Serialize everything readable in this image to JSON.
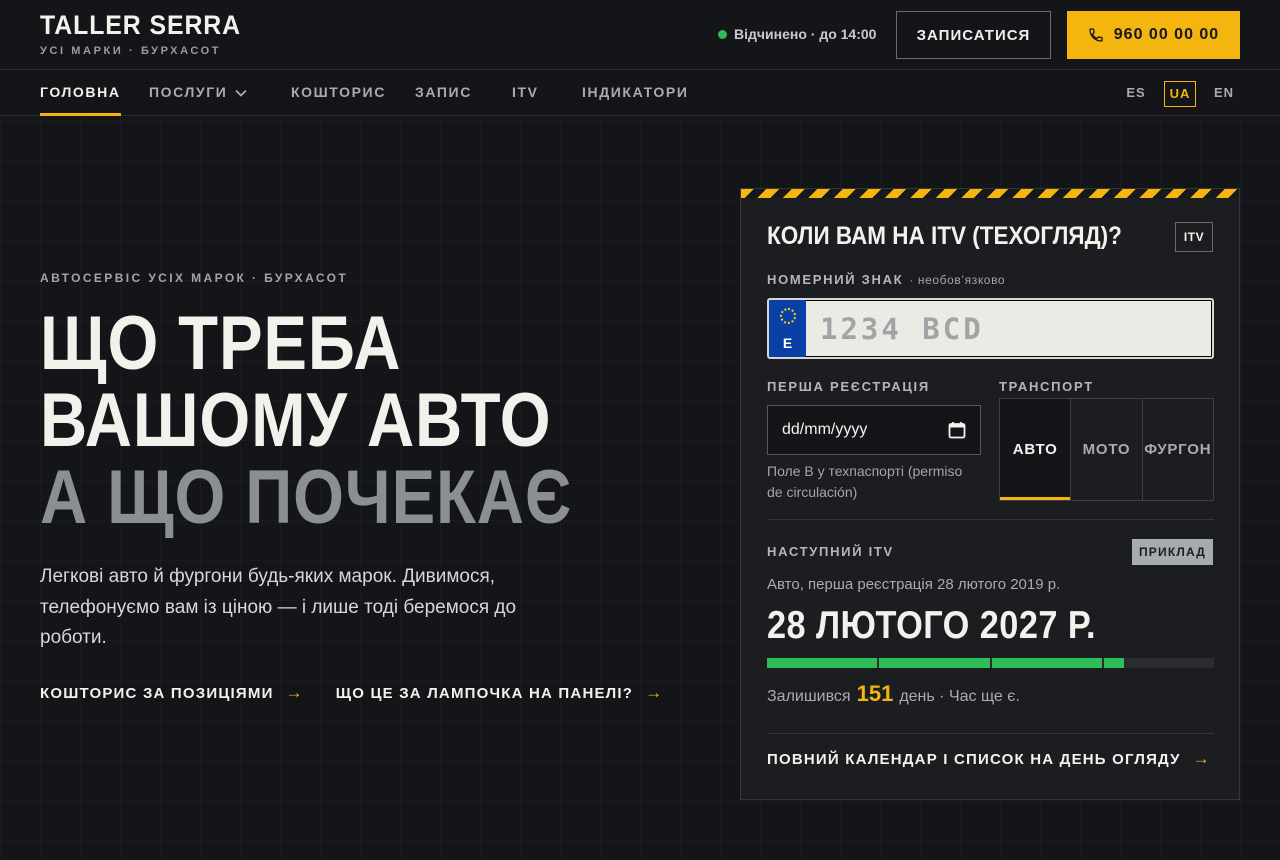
{
  "brand": {
    "name": "TALLER SERRA",
    "tagline": "УСІ МАРКИ · БУРХАСОТ"
  },
  "header": {
    "status_text": "Відчинено · до 14:00",
    "book_label": "ЗАПИСАТИСЯ",
    "phone_label": "960 00 00 00",
    "accent_color": "#f5b50f",
    "status_color": "#2dbe5a"
  },
  "nav": {
    "items": [
      {
        "label": "ГОЛОВНА"
      },
      {
        "label": "ПОСЛУГИ"
      },
      {
        "label": "КОШТОРИС"
      },
      {
        "label": "ЗАПИС"
      },
      {
        "label": "ITV"
      },
      {
        "label": "ІНДИКАТОРИ"
      }
    ],
    "active_index": 0,
    "languages": [
      "ES",
      "UA",
      "EN"
    ],
    "active_language": "UA"
  },
  "hero": {
    "eyebrow": "АВТОСЕРВІС УСІХ МАРОК · БУРХАСОТ",
    "headline_1": "ЩО ТРЕБА",
    "headline_2": "ВАШОМУ АВТО",
    "headline_3": "А ЩО ПОЧЕКАЄ",
    "lead": "Легкові авто й фургони будь-яких марок. Дивимося, телефонуємо вам із ціною — і лише тоді беремося до роботи.",
    "link_1": "КОШТОРИС ЗА ПОЗИЦІЯМИ",
    "link_2": "ЩО ЦЕ ЗА ЛАМПОЧКА НА ПАНЕЛІ?"
  },
  "itv_card": {
    "title": "КОЛИ ВАМ НА ITV (ТЕХОГЛЯД)?",
    "badge": "ITV",
    "plate_label": "НОМЕРНИЙ ЗНАК",
    "plate_optional": "· необов’язково",
    "plate_country": "E",
    "plate_placeholder": "1234 BCD",
    "plate_value": "",
    "reg_label": "ПЕРША РЕЄСТРАЦІЯ",
    "reg_placeholder": "dd/mm/yyyy",
    "reg_hint": "Поле B у техпаспорті (permiso de circulación)",
    "transport_label": "ТРАНСПОРТ",
    "transport_options": [
      "АВТО",
      "МОТО",
      "ФУРГОН"
    ],
    "transport_selected": "АВТО",
    "next_label": "НАСТУПНИЙ ITV",
    "example_badge": "ПРИКЛАД",
    "summary": "Авто, перша реєстрація 28 лютого 2019 р.",
    "next_date": "28 ЛЮТОГО 2027 Р.",
    "progress_segments": [
      1,
      1,
      1,
      0.18
    ],
    "remaining_prefix": "Залишився",
    "remaining_days": "151",
    "remaining_suffix": "день · Час ще є.",
    "calendar_link": "ПОВНИЙ КАЛЕНДАР І СПИСОК НА ДЕНЬ ОГЛЯДУ"
  }
}
